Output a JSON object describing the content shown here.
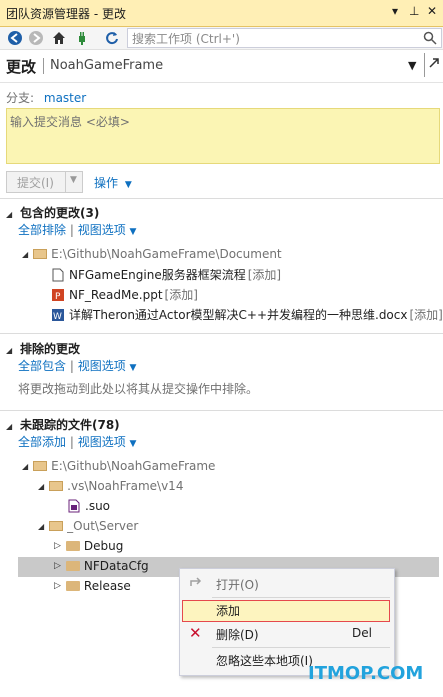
{
  "window": {
    "title": "团队资源管理器 - 更改"
  },
  "toolbar": {
    "search_placeholder": "搜索工作项 (Ctrl+')"
  },
  "header": {
    "title": "更改",
    "repo": "NoahGameFrame"
  },
  "branch": {
    "label": "分支:",
    "name": "master"
  },
  "commit": {
    "message_placeholder": "输入提交消息 <必填>",
    "commit_label": "提交(I)",
    "actions_label": "操作"
  },
  "included": {
    "title": "包含的更改(3)",
    "exclude_all": "全部排除",
    "view_options": "视图选项",
    "folder": "E:\\Github\\NoahGameFrame\\Document",
    "files": [
      {
        "name": "NFGameEngine服务器框架流程",
        "tag": "[添加]"
      },
      {
        "name": "NF_ReadMe.ppt",
        "tag": "[添加]"
      },
      {
        "name": "详解Theron通过Actor模型解决C++并发编程的一种思维.docx",
        "tag": "[添加]"
      }
    ]
  },
  "excluded": {
    "title": "排除的更改",
    "include_all": "全部包含",
    "view_options": "视图选项",
    "hint": "将更改拖动到此处以将其从提交操作中排除。"
  },
  "untracked": {
    "title": "未跟踪的文件(78)",
    "add_all": "全部添加",
    "view_options": "视图选项",
    "root": "E:\\Github\\NoahGameFrame",
    "vs_folder": ".vs\\NoahFrame\\v14",
    "suo": ".suo",
    "out_folder": "_Out\\Server",
    "subfolders": [
      "Debug",
      "NFDataCfg",
      "Release"
    ]
  },
  "context_menu": {
    "open": "打开(O)",
    "add": "添加",
    "delete": "删除(D)",
    "delete_shortcut": "Del",
    "ignore": "忽略这些本地项(I)"
  },
  "watermark": "ITMOP.COM",
  "colors": {
    "accent": "#0e70c0",
    "titlebar": "#ffefb5",
    "commit_box": "#fbf5b4",
    "highlight_border": "#e5484d"
  }
}
